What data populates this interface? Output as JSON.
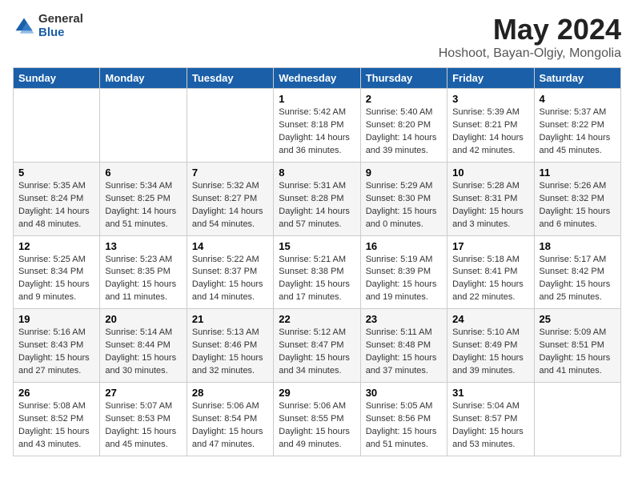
{
  "header": {
    "logo_general": "General",
    "logo_blue": "Blue",
    "month_year": "May 2024",
    "location": "Hoshoot, Bayan-Olgiy, Mongolia"
  },
  "days_of_week": [
    "Sunday",
    "Monday",
    "Tuesday",
    "Wednesday",
    "Thursday",
    "Friday",
    "Saturday"
  ],
  "weeks": [
    [
      {
        "day": "",
        "info": ""
      },
      {
        "day": "",
        "info": ""
      },
      {
        "day": "",
        "info": ""
      },
      {
        "day": "1",
        "info": "Sunrise: 5:42 AM\nSunset: 8:18 PM\nDaylight: 14 hours\nand 36 minutes."
      },
      {
        "day": "2",
        "info": "Sunrise: 5:40 AM\nSunset: 8:20 PM\nDaylight: 14 hours\nand 39 minutes."
      },
      {
        "day": "3",
        "info": "Sunrise: 5:39 AM\nSunset: 8:21 PM\nDaylight: 14 hours\nand 42 minutes."
      },
      {
        "day": "4",
        "info": "Sunrise: 5:37 AM\nSunset: 8:22 PM\nDaylight: 14 hours\nand 45 minutes."
      }
    ],
    [
      {
        "day": "5",
        "info": "Sunrise: 5:35 AM\nSunset: 8:24 PM\nDaylight: 14 hours\nand 48 minutes."
      },
      {
        "day": "6",
        "info": "Sunrise: 5:34 AM\nSunset: 8:25 PM\nDaylight: 14 hours\nand 51 minutes."
      },
      {
        "day": "7",
        "info": "Sunrise: 5:32 AM\nSunset: 8:27 PM\nDaylight: 14 hours\nand 54 minutes."
      },
      {
        "day": "8",
        "info": "Sunrise: 5:31 AM\nSunset: 8:28 PM\nDaylight: 14 hours\nand 57 minutes."
      },
      {
        "day": "9",
        "info": "Sunrise: 5:29 AM\nSunset: 8:30 PM\nDaylight: 15 hours\nand 0 minutes."
      },
      {
        "day": "10",
        "info": "Sunrise: 5:28 AM\nSunset: 8:31 PM\nDaylight: 15 hours\nand 3 minutes."
      },
      {
        "day": "11",
        "info": "Sunrise: 5:26 AM\nSunset: 8:32 PM\nDaylight: 15 hours\nand 6 minutes."
      }
    ],
    [
      {
        "day": "12",
        "info": "Sunrise: 5:25 AM\nSunset: 8:34 PM\nDaylight: 15 hours\nand 9 minutes."
      },
      {
        "day": "13",
        "info": "Sunrise: 5:23 AM\nSunset: 8:35 PM\nDaylight: 15 hours\nand 11 minutes."
      },
      {
        "day": "14",
        "info": "Sunrise: 5:22 AM\nSunset: 8:37 PM\nDaylight: 15 hours\nand 14 minutes."
      },
      {
        "day": "15",
        "info": "Sunrise: 5:21 AM\nSunset: 8:38 PM\nDaylight: 15 hours\nand 17 minutes."
      },
      {
        "day": "16",
        "info": "Sunrise: 5:19 AM\nSunset: 8:39 PM\nDaylight: 15 hours\nand 19 minutes."
      },
      {
        "day": "17",
        "info": "Sunrise: 5:18 AM\nSunset: 8:41 PM\nDaylight: 15 hours\nand 22 minutes."
      },
      {
        "day": "18",
        "info": "Sunrise: 5:17 AM\nSunset: 8:42 PM\nDaylight: 15 hours\nand 25 minutes."
      }
    ],
    [
      {
        "day": "19",
        "info": "Sunrise: 5:16 AM\nSunset: 8:43 PM\nDaylight: 15 hours\nand 27 minutes."
      },
      {
        "day": "20",
        "info": "Sunrise: 5:14 AM\nSunset: 8:44 PM\nDaylight: 15 hours\nand 30 minutes."
      },
      {
        "day": "21",
        "info": "Sunrise: 5:13 AM\nSunset: 8:46 PM\nDaylight: 15 hours\nand 32 minutes."
      },
      {
        "day": "22",
        "info": "Sunrise: 5:12 AM\nSunset: 8:47 PM\nDaylight: 15 hours\nand 34 minutes."
      },
      {
        "day": "23",
        "info": "Sunrise: 5:11 AM\nSunset: 8:48 PM\nDaylight: 15 hours\nand 37 minutes."
      },
      {
        "day": "24",
        "info": "Sunrise: 5:10 AM\nSunset: 8:49 PM\nDaylight: 15 hours\nand 39 minutes."
      },
      {
        "day": "25",
        "info": "Sunrise: 5:09 AM\nSunset: 8:51 PM\nDaylight: 15 hours\nand 41 minutes."
      }
    ],
    [
      {
        "day": "26",
        "info": "Sunrise: 5:08 AM\nSunset: 8:52 PM\nDaylight: 15 hours\nand 43 minutes."
      },
      {
        "day": "27",
        "info": "Sunrise: 5:07 AM\nSunset: 8:53 PM\nDaylight: 15 hours\nand 45 minutes."
      },
      {
        "day": "28",
        "info": "Sunrise: 5:06 AM\nSunset: 8:54 PM\nDaylight: 15 hours\nand 47 minutes."
      },
      {
        "day": "29",
        "info": "Sunrise: 5:06 AM\nSunset: 8:55 PM\nDaylight: 15 hours\nand 49 minutes."
      },
      {
        "day": "30",
        "info": "Sunrise: 5:05 AM\nSunset: 8:56 PM\nDaylight: 15 hours\nand 51 minutes."
      },
      {
        "day": "31",
        "info": "Sunrise: 5:04 AM\nSunset: 8:57 PM\nDaylight: 15 hours\nand 53 minutes."
      },
      {
        "day": "",
        "info": ""
      }
    ]
  ]
}
